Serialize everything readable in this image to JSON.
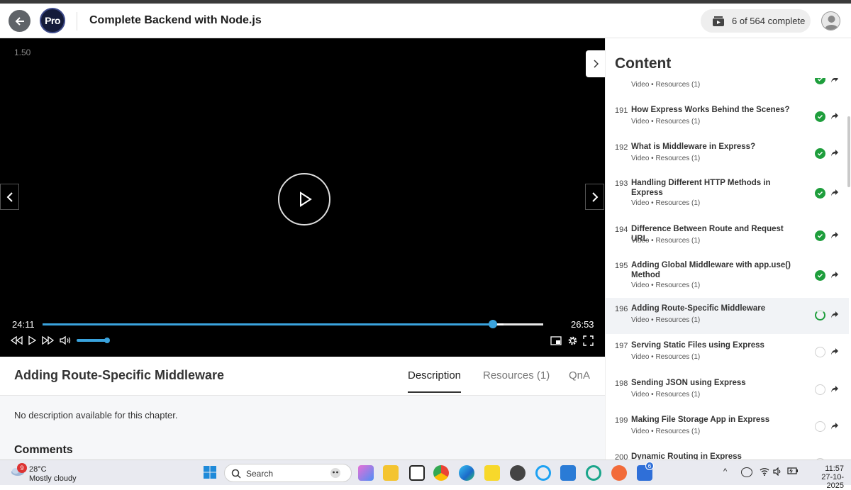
{
  "header": {
    "logo_text": "Pro",
    "course_title": "Complete Backend with Node.js",
    "progress_text": "6 of 564 complete"
  },
  "player": {
    "speed": "1.50",
    "current_time": "24:11",
    "duration": "26:53",
    "progress_fraction": 0.9,
    "buffered_fraction": 0.92,
    "volume_fraction": 1.0
  },
  "chapter": {
    "title": "Adding Route-Specific Middleware",
    "tabs": [
      "Description",
      "Resources (1)",
      "QnA"
    ],
    "active_tab": "Description",
    "description": "No description available for this chapter.",
    "comments_heading": "Comments"
  },
  "sidebar": {
    "heading": "Content",
    "partial_item_meta": "Video • Resources (1)",
    "items": [
      {
        "num": "191",
        "title": "How Express Works Behind the Scenes?",
        "meta": "Video • Resources (1)",
        "status": "done"
      },
      {
        "num": "192",
        "title": "What is Middleware in Express?",
        "meta": "Video • Resources (1)",
        "status": "done"
      },
      {
        "num": "193",
        "title": "Handling Different HTTP Methods in Express",
        "meta": "Video • Resources (1)",
        "status": "done"
      },
      {
        "num": "194",
        "title": "Difference Between Route and Request URL",
        "meta": "Video • Resources (1)",
        "status": "done"
      },
      {
        "num": "195",
        "title": "Adding Global Middleware with app.use() Method",
        "meta": "Video • Resources (1)",
        "status": "done"
      },
      {
        "num": "196",
        "title": "Adding Route-Specific Middleware",
        "meta": "Video • Resources (1)",
        "status": "in-progress"
      },
      {
        "num": "197",
        "title": "Serving Static Files using Express",
        "meta": "Video • Resources (1)",
        "status": "none"
      },
      {
        "num": "198",
        "title": "Sending JSON using Express",
        "meta": "Video • Resources (1)",
        "status": "none"
      },
      {
        "num": "199",
        "title": "Making File Storage App in Express",
        "meta": "Video • Resources (1)",
        "status": "none"
      },
      {
        "num": "200",
        "title": "Dynamic Routing in Express",
        "meta": "",
        "status": "none"
      }
    ]
  },
  "taskbar": {
    "weather_badge": "9",
    "temperature": "28°C",
    "condition": "Mostly cloudy",
    "search_placeholder": "Search",
    "clock_time": "11:57",
    "clock_date": "27-10-2025",
    "tray_badge": "6"
  },
  "colors": {
    "accent": "#3aa3dd",
    "done": "#1e9e3c"
  }
}
